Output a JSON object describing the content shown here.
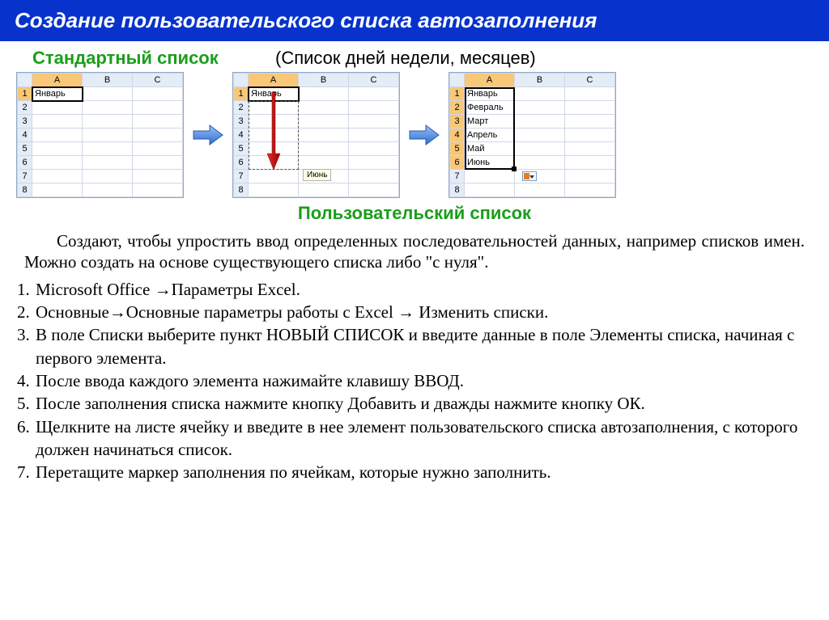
{
  "title": "Создание пользовательского списка автозаполнения",
  "heading_green1": "Стандартный список",
  "heading_black": "(Список дней недели, месяцев)",
  "heading_green2": "Пользовательский  список",
  "cols": [
    "A",
    "B",
    "C"
  ],
  "rows8": [
    "1",
    "2",
    "3",
    "4",
    "5",
    "6",
    "7",
    "8"
  ],
  "panel1": {
    "a1": "Январь"
  },
  "panel2": {
    "a1": "Январь",
    "tooltip": "Июнь"
  },
  "panel3": {
    "values": [
      "Январь",
      "Февраль",
      "Март",
      "Апрель",
      "Май",
      "Июнь"
    ]
  },
  "paragraph": "Создают, чтобы упростить ввод определенных последовательностей данных, например списков имен.  Можно создать на основе существующего списка либо \"с нуля\".",
  "steps": [
    "Microsoft Office →Параметры Excel.",
    "Основные→Основные параметры работы с Excel → Изменить списки.",
    "В поле Списки выберите пункт НОВЫЙ СПИСОК и введите данные в поле Элементы списка, начиная с первого элемента.",
    "После ввода каждого элемента нажимайте клавишу ВВОД.",
    "После заполнения списка нажмите кнопку Добавить и дважды нажмите кнопку ОК.",
    "Щелкните на листе ячейку и введите в нее элемент пользовательского списка автозаполнения, с которого должен начинаться список.",
    "Перетащите маркер заполнения по ячейкам, которые нужно заполнить."
  ]
}
